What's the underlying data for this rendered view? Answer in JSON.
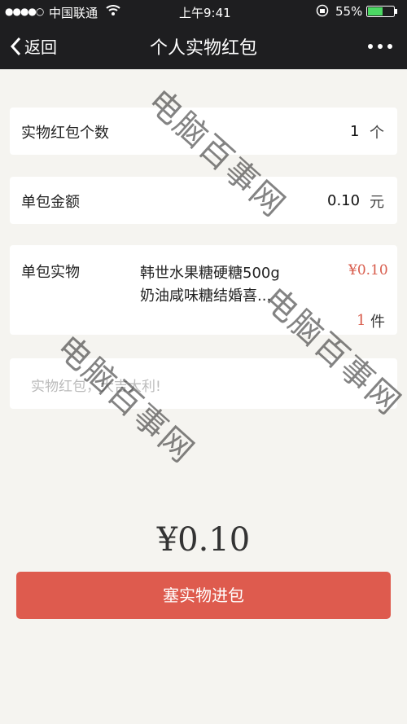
{
  "status_bar": {
    "signal": "●●●●○",
    "carrier": "中国联通",
    "wifi_icon": "wifi-icon",
    "time": "上午9:41",
    "lock_icon": "rotation-lock-icon",
    "battery": "55%"
  },
  "nav": {
    "back_label": "返回",
    "title": "个人实物红包",
    "more_icon": "more-icon"
  },
  "count_row": {
    "label": "实物红包个数",
    "value": "1",
    "unit": "个"
  },
  "amount_row": {
    "label": "单包金额",
    "value": "0.10",
    "unit": "元"
  },
  "item_row": {
    "label": "单包实物",
    "name_line1": "韩世水果糖硬糖500g",
    "name_line2": "奶油咸味糖结婚喜...",
    "price": "¥0.10",
    "qty": "1",
    "qty_unit": "件"
  },
  "message": {
    "placeholder": "实物红包，大吉大利!"
  },
  "total": "¥0.10",
  "submit_label": "塞实物进包",
  "watermark": "电脑百事网",
  "colors": {
    "bar": "#1e1e20",
    "accent": "#de5b4e",
    "background": "#f5f4f0"
  }
}
